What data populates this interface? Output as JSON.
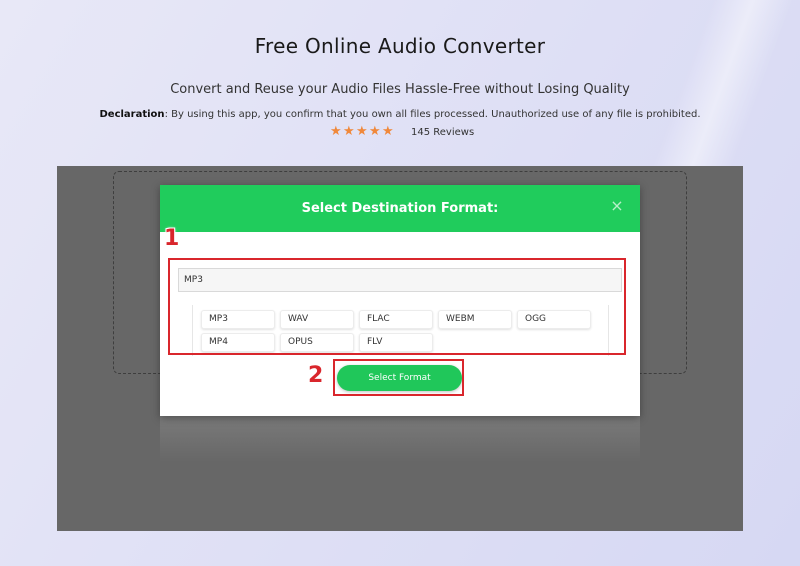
{
  "header": {
    "title": "Free Online Audio Converter",
    "subtitle": "Convert and Reuse your Audio Files Hassle-Free without Losing Quality",
    "declaration_label": "Declaration",
    "declaration_text": ": By using this app, you confirm that you own all files processed. Unauthorized use of any file is prohibited.",
    "rating": {
      "stars": 5,
      "reviews": "145 Reviews"
    }
  },
  "modal": {
    "title": "Select Destination Format:",
    "close_icon": "close-icon",
    "selected_format": "MP3",
    "formats": [
      "MP3",
      "WAV",
      "FLAC",
      "WEBM",
      "OGG",
      "MP4",
      "OPUS",
      "FLV"
    ],
    "button_label": "Select Format"
  },
  "annotations": {
    "step1": "1",
    "step2": "2",
    "color": "#d9262c"
  },
  "colors": {
    "accent_green": "#20cc5c",
    "star_orange": "#f0883a",
    "overlay_gray": "#676767"
  }
}
